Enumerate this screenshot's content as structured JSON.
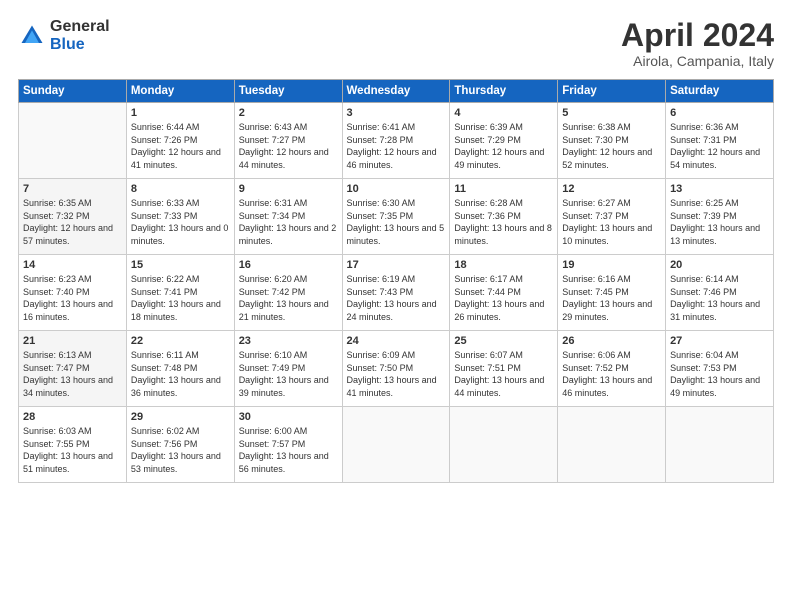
{
  "header": {
    "logo_general": "General",
    "logo_blue": "Blue",
    "title": "April 2024",
    "subtitle": "Airola, Campania, Italy"
  },
  "days_of_week": [
    "Sunday",
    "Monday",
    "Tuesday",
    "Wednesday",
    "Thursday",
    "Friday",
    "Saturday"
  ],
  "weeks": [
    [
      {
        "day": "",
        "sunrise": "",
        "sunset": "",
        "daylight": ""
      },
      {
        "day": "1",
        "sunrise": "Sunrise: 6:44 AM",
        "sunset": "Sunset: 7:26 PM",
        "daylight": "Daylight: 12 hours and 41 minutes."
      },
      {
        "day": "2",
        "sunrise": "Sunrise: 6:43 AM",
        "sunset": "Sunset: 7:27 PM",
        "daylight": "Daylight: 12 hours and 44 minutes."
      },
      {
        "day": "3",
        "sunrise": "Sunrise: 6:41 AM",
        "sunset": "Sunset: 7:28 PM",
        "daylight": "Daylight: 12 hours and 46 minutes."
      },
      {
        "day": "4",
        "sunrise": "Sunrise: 6:39 AM",
        "sunset": "Sunset: 7:29 PM",
        "daylight": "Daylight: 12 hours and 49 minutes."
      },
      {
        "day": "5",
        "sunrise": "Sunrise: 6:38 AM",
        "sunset": "Sunset: 7:30 PM",
        "daylight": "Daylight: 12 hours and 52 minutes."
      },
      {
        "day": "6",
        "sunrise": "Sunrise: 6:36 AM",
        "sunset": "Sunset: 7:31 PM",
        "daylight": "Daylight: 12 hours and 54 minutes."
      }
    ],
    [
      {
        "day": "7",
        "sunrise": "Sunrise: 6:35 AM",
        "sunset": "Sunset: 7:32 PM",
        "daylight": "Daylight: 12 hours and 57 minutes."
      },
      {
        "day": "8",
        "sunrise": "Sunrise: 6:33 AM",
        "sunset": "Sunset: 7:33 PM",
        "daylight": "Daylight: 13 hours and 0 minutes."
      },
      {
        "day": "9",
        "sunrise": "Sunrise: 6:31 AM",
        "sunset": "Sunset: 7:34 PM",
        "daylight": "Daylight: 13 hours and 2 minutes."
      },
      {
        "day": "10",
        "sunrise": "Sunrise: 6:30 AM",
        "sunset": "Sunset: 7:35 PM",
        "daylight": "Daylight: 13 hours and 5 minutes."
      },
      {
        "day": "11",
        "sunrise": "Sunrise: 6:28 AM",
        "sunset": "Sunset: 7:36 PM",
        "daylight": "Daylight: 13 hours and 8 minutes."
      },
      {
        "day": "12",
        "sunrise": "Sunrise: 6:27 AM",
        "sunset": "Sunset: 7:37 PM",
        "daylight": "Daylight: 13 hours and 10 minutes."
      },
      {
        "day": "13",
        "sunrise": "Sunrise: 6:25 AM",
        "sunset": "Sunset: 7:39 PM",
        "daylight": "Daylight: 13 hours and 13 minutes."
      }
    ],
    [
      {
        "day": "14",
        "sunrise": "Sunrise: 6:23 AM",
        "sunset": "Sunset: 7:40 PM",
        "daylight": "Daylight: 13 hours and 16 minutes."
      },
      {
        "day": "15",
        "sunrise": "Sunrise: 6:22 AM",
        "sunset": "Sunset: 7:41 PM",
        "daylight": "Daylight: 13 hours and 18 minutes."
      },
      {
        "day": "16",
        "sunrise": "Sunrise: 6:20 AM",
        "sunset": "Sunset: 7:42 PM",
        "daylight": "Daylight: 13 hours and 21 minutes."
      },
      {
        "day": "17",
        "sunrise": "Sunrise: 6:19 AM",
        "sunset": "Sunset: 7:43 PM",
        "daylight": "Daylight: 13 hours and 24 minutes."
      },
      {
        "day": "18",
        "sunrise": "Sunrise: 6:17 AM",
        "sunset": "Sunset: 7:44 PM",
        "daylight": "Daylight: 13 hours and 26 minutes."
      },
      {
        "day": "19",
        "sunrise": "Sunrise: 6:16 AM",
        "sunset": "Sunset: 7:45 PM",
        "daylight": "Daylight: 13 hours and 29 minutes."
      },
      {
        "day": "20",
        "sunrise": "Sunrise: 6:14 AM",
        "sunset": "Sunset: 7:46 PM",
        "daylight": "Daylight: 13 hours and 31 minutes."
      }
    ],
    [
      {
        "day": "21",
        "sunrise": "Sunrise: 6:13 AM",
        "sunset": "Sunset: 7:47 PM",
        "daylight": "Daylight: 13 hours and 34 minutes."
      },
      {
        "day": "22",
        "sunrise": "Sunrise: 6:11 AM",
        "sunset": "Sunset: 7:48 PM",
        "daylight": "Daylight: 13 hours and 36 minutes."
      },
      {
        "day": "23",
        "sunrise": "Sunrise: 6:10 AM",
        "sunset": "Sunset: 7:49 PM",
        "daylight": "Daylight: 13 hours and 39 minutes."
      },
      {
        "day": "24",
        "sunrise": "Sunrise: 6:09 AM",
        "sunset": "Sunset: 7:50 PM",
        "daylight": "Daylight: 13 hours and 41 minutes."
      },
      {
        "day": "25",
        "sunrise": "Sunrise: 6:07 AM",
        "sunset": "Sunset: 7:51 PM",
        "daylight": "Daylight: 13 hours and 44 minutes."
      },
      {
        "day": "26",
        "sunrise": "Sunrise: 6:06 AM",
        "sunset": "Sunset: 7:52 PM",
        "daylight": "Daylight: 13 hours and 46 minutes."
      },
      {
        "day": "27",
        "sunrise": "Sunrise: 6:04 AM",
        "sunset": "Sunset: 7:53 PM",
        "daylight": "Daylight: 13 hours and 49 minutes."
      }
    ],
    [
      {
        "day": "28",
        "sunrise": "Sunrise: 6:03 AM",
        "sunset": "Sunset: 7:55 PM",
        "daylight": "Daylight: 13 hours and 51 minutes."
      },
      {
        "day": "29",
        "sunrise": "Sunrise: 6:02 AM",
        "sunset": "Sunset: 7:56 PM",
        "daylight": "Daylight: 13 hours and 53 minutes."
      },
      {
        "day": "30",
        "sunrise": "Sunrise: 6:00 AM",
        "sunset": "Sunset: 7:57 PM",
        "daylight": "Daylight: 13 hours and 56 minutes."
      },
      {
        "day": "",
        "sunrise": "",
        "sunset": "",
        "daylight": ""
      },
      {
        "day": "",
        "sunrise": "",
        "sunset": "",
        "daylight": ""
      },
      {
        "day": "",
        "sunrise": "",
        "sunset": "",
        "daylight": ""
      },
      {
        "day": "",
        "sunrise": "",
        "sunset": "",
        "daylight": ""
      }
    ]
  ]
}
